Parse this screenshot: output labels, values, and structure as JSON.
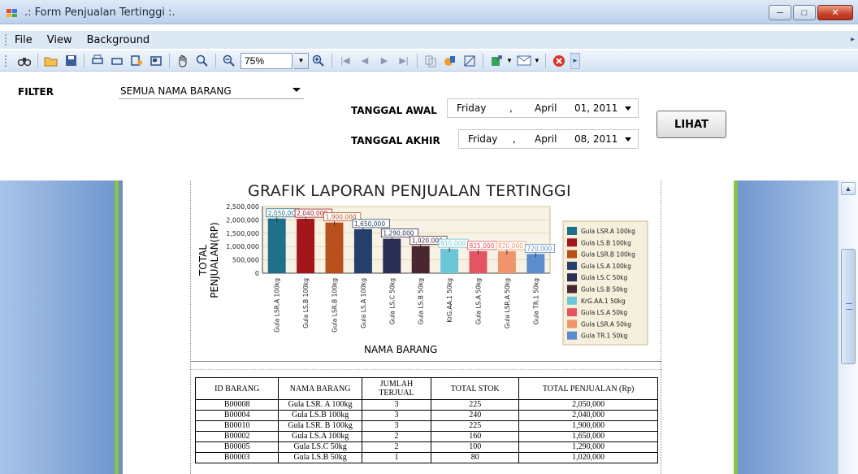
{
  "window": {
    "title": ".: Form Penjualan Tertinggi :."
  },
  "menu": {
    "items": [
      "File",
      "View",
      "Background"
    ]
  },
  "toolbar": {
    "zoom": "75%"
  },
  "filter": {
    "label": "FILTER",
    "selected": "SEMUA NAMA BARANG",
    "start_label": "TANGGAL AWAL",
    "start_date": {
      "day": "Friday",
      "sep": ",",
      "month": "April",
      "daynum": "01, 2011"
    },
    "end_label": "TANGGAL AKHIR",
    "end_date": {
      "day": "Friday",
      "sep": ",",
      "month": "April",
      "daynum": "08, 2011"
    },
    "button_label": "LIHAT"
  },
  "colors": {
    "series": [
      "#1f6e8c",
      "#a3161a",
      "#b9501b",
      "#243f6b",
      "#2b2e55",
      "#4a2630",
      "#6cc6d8",
      "#e45563",
      "#f0956b",
      "#5b8ccc"
    ]
  },
  "chart_data": {
    "type": "bar",
    "title": "GRAFIK LAPORAN PENJUALAN TERTINGGI",
    "xlabel": "NAMA BARANG",
    "ylabel": "TOTAL PENJUALAN(RP)",
    "ylim": [
      0,
      2500000
    ],
    "yticks": [
      "2,500,000",
      "2,000,000",
      "1,500,000",
      "1,000,000",
      "500,000",
      "0"
    ],
    "ytick_values": [
      2500000,
      2000000,
      1500000,
      1000000,
      500000,
      0
    ],
    "categories": [
      "Gula LSR.A 100kg",
      "Gula LS.B 100kg",
      "Gula LSR.B 100kg",
      "Gula LS.A 100kg",
      "Gula LS.C 50kg",
      "Gula LS.B 50kg",
      "KrG.AA.1 50kg",
      "Gula LS.A 50kg",
      "Gula LSR.A 50kg",
      "Gula TR.1 50kg"
    ],
    "values": [
      2050000,
      2040000,
      1900000,
      1650000,
      1290000,
      1020000,
      910000,
      825000,
      820000,
      720000
    ],
    "data_labels": [
      "2,050,0C",
      "2,040,000",
      "1,900,000",
      "1,650,000",
      "1,290,000",
      "1,020,000",
      "910,000",
      "825,000",
      "820,000",
      "720,000"
    ],
    "legend": [
      "Gula LSR.A 100kg",
      "Gula LS.B 100kg",
      "Gula LSR.B 100kg",
      "Gula LS.A 100kg",
      "Gula LS.C 50kg",
      "Gula LS.B 50kg",
      "KrG.AA.1 50kg",
      "Gula LS.A 50kg",
      "Gula LSR.A 50kg",
      "Gula TR.1 50kg"
    ],
    "legend_position": "right",
    "grid": true
  },
  "table": {
    "headers": [
      "ID BARANG",
      "NAMA BARANG",
      "JUMLAH TERJUAL",
      "TOTAL STOK",
      "TOTAL PENJUALAN (Rp)"
    ],
    "rows": [
      [
        "B00008",
        "Gula LSR. A 100kg",
        "3",
        "225",
        "2,050,000"
      ],
      [
        "B00004",
        "Gula LS.B 100kg",
        "3",
        "240",
        "2,040,000"
      ],
      [
        "B00010",
        "Gula LSR. B 100kg",
        "3",
        "225",
        "1,900,000"
      ],
      [
        "B00002",
        "Gula LS.A 100kg",
        "2",
        "160",
        "1,650,000"
      ],
      [
        "B00005",
        "Gula LS.C 50kg",
        "2",
        "100",
        "1,290,000"
      ],
      [
        "B00003",
        "Gula LS.B 50kg",
        "1",
        "80",
        "1,020,000"
      ]
    ]
  }
}
